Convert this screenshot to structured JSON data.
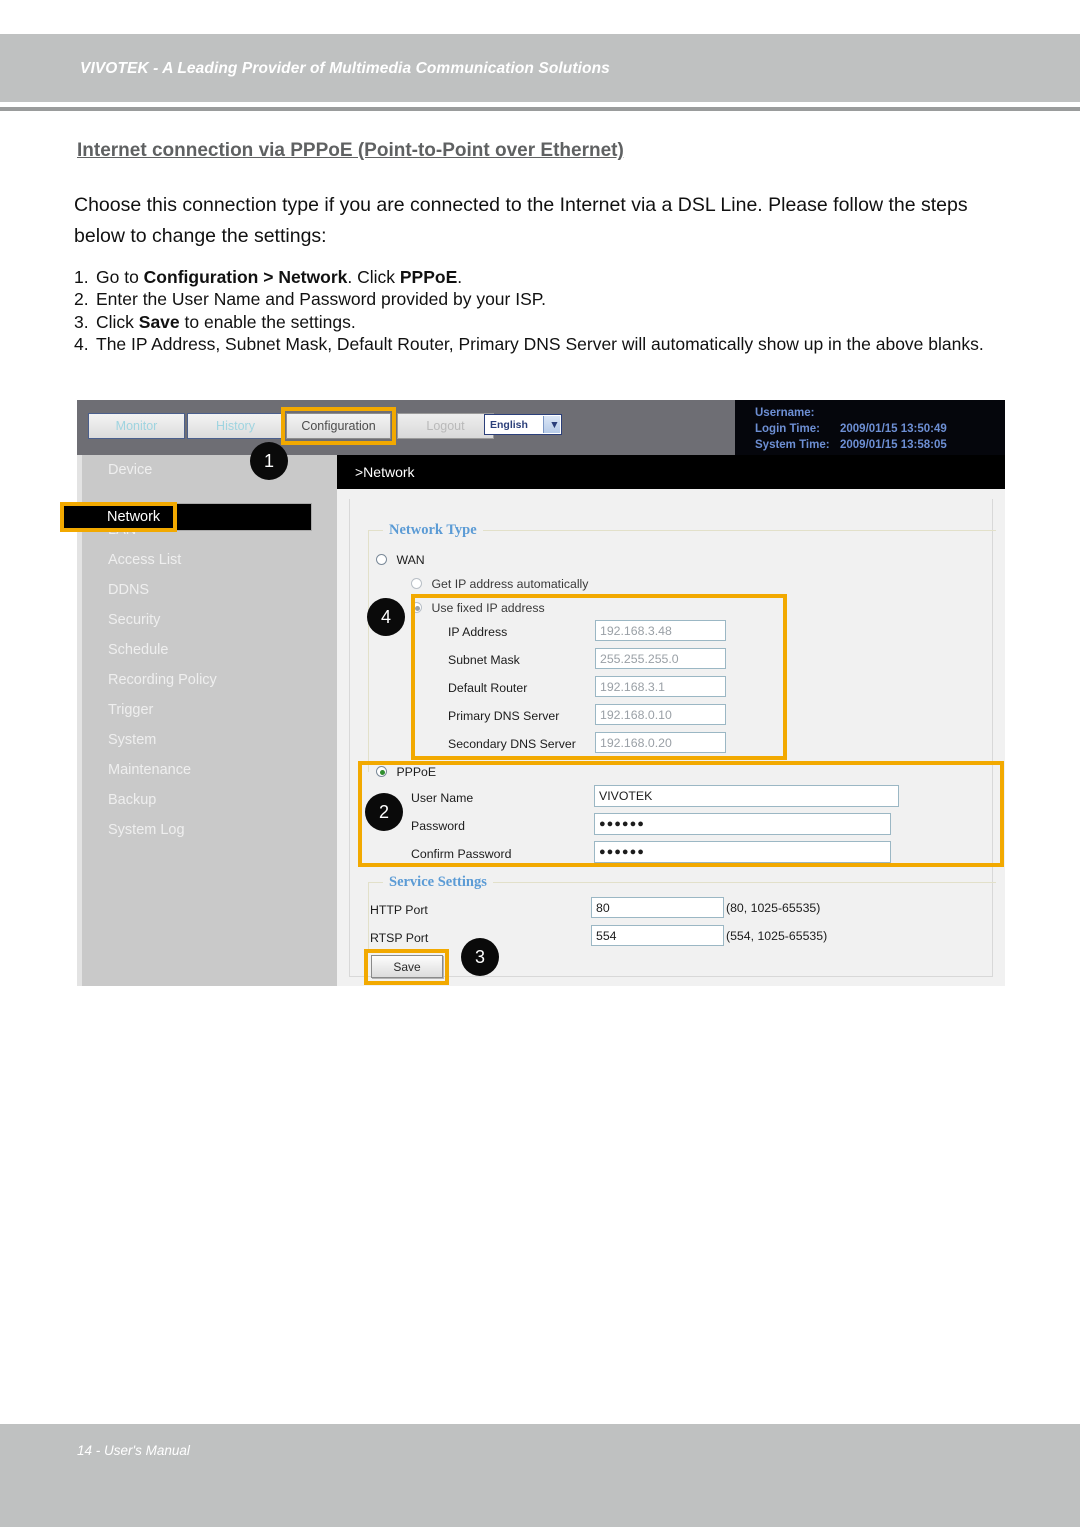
{
  "page": {
    "header_title": "VIVOTEK - A Leading Provider of Multimedia Communication Solutions",
    "section_heading": "Internet connection via PPPoE (Point-to-Point over Ethernet)",
    "intro": "Choose this connection type if you are connected to the Internet via a DSL Line. Please follow the steps below to change the settings:",
    "footer": "14 - User's Manual",
    "accent_color": "#f2a900",
    "header_band_color": "#bfc1c1"
  },
  "steps": [
    {
      "num": "1.",
      "pre": "Go to ",
      "bold1": "Configuration > Network",
      "mid": ". Click ",
      "bold2": "PPPoE",
      "post": "."
    },
    {
      "num": "2.",
      "pre": "Enter the User Name and Password provided by your ISP.",
      "bold1": "",
      "mid": "",
      "bold2": "",
      "post": ""
    },
    {
      "num": "3.",
      "pre": "Click ",
      "bold1": "Save",
      "mid": " to enable the settings.",
      "bold2": "",
      "post": ""
    },
    {
      "num": "4.",
      "pre": "The IP Address, Subnet Mask, Default Router, Primary DNS Server will automatically show up in the above blanks.",
      "bold1": "",
      "mid": "",
      "bold2": "",
      "post": ""
    }
  ],
  "screenshot": {
    "topnav": {
      "monitor": "Monitor",
      "history": "History",
      "configuration": "Configuration",
      "logout": "Logout",
      "language_selected": "English",
      "language_caret": "▼"
    },
    "info": {
      "username_label": "Username:",
      "username_value": "",
      "login_time_label": "Login Time:",
      "login_time_value": "2009/01/15 13:50:49",
      "system_time_label": "System Time:",
      "system_time_value": "2009/01/15 13:58:05"
    },
    "sidebar": [
      "Device",
      "Network",
      "LAN",
      "Access List",
      "DDNS",
      "Security",
      "Schedule",
      "Recording Policy",
      "Trigger",
      "System",
      "Maintenance",
      "Backup",
      "System Log"
    ],
    "sidebar_selected": "Network",
    "main_title": ">Network",
    "network_type": {
      "legend": "Network Type",
      "wan_label": "WAN",
      "get_ip_auto_label": "Get IP address automatically",
      "use_fixed_ip_label": "Use fixed IP address",
      "fields": [
        {
          "label": "IP Address",
          "value": "192.168.3.48"
        },
        {
          "label": "Subnet Mask",
          "value": "255.255.255.0"
        },
        {
          "label": "Default Router",
          "value": "192.168.3.1"
        },
        {
          "label": "Primary DNS Server",
          "value": "192.168.0.10"
        },
        {
          "label": "Secondary DNS Server",
          "value": "192.168.0.20"
        }
      ]
    },
    "pppoe": {
      "label": "PPPoE",
      "fields": [
        {
          "label": "User Name",
          "value": "VIVOTEK"
        },
        {
          "label": "Password",
          "value": "●●●●●●"
        },
        {
          "label": "Confirm Password",
          "value": "●●●●●●"
        }
      ]
    },
    "service_settings": {
      "legend": "Service Settings",
      "rows": [
        {
          "label": "HTTP Port",
          "value": "80",
          "hint": "(80, 1025-65535)"
        },
        {
          "label": "RTSP Port",
          "value": "554",
          "hint": "(554, 1025-65535)"
        }
      ],
      "save_label": "Save"
    },
    "badges": [
      "1",
      "2",
      "3",
      "4"
    ]
  }
}
